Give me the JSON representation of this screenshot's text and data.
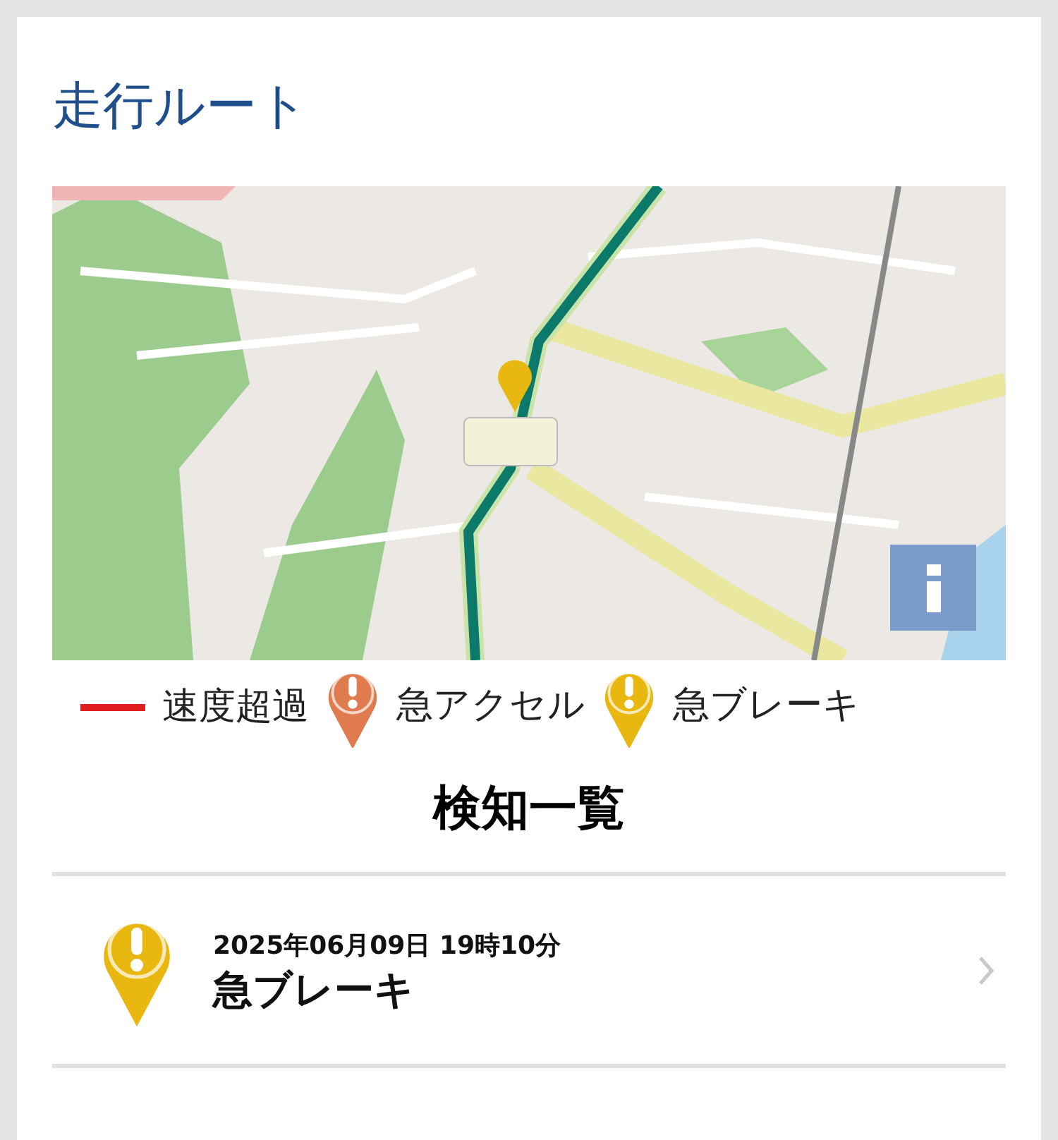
{
  "route": {
    "title": "走行ルート"
  },
  "legend": [
    {
      "kind": "line",
      "label": "速度超過",
      "color": "#e02020"
    },
    {
      "kind": "pin",
      "label": "急アクセル",
      "color": "#e07a4f"
    },
    {
      "kind": "pin",
      "label": "急ブレーキ",
      "color": "#e8b710"
    }
  ],
  "detections": {
    "title": "検知一覧",
    "items": [
      {
        "kind": "brake",
        "datetime": "2025年06月09日 19時10分",
        "label": "急ブレーキ"
      }
    ]
  }
}
